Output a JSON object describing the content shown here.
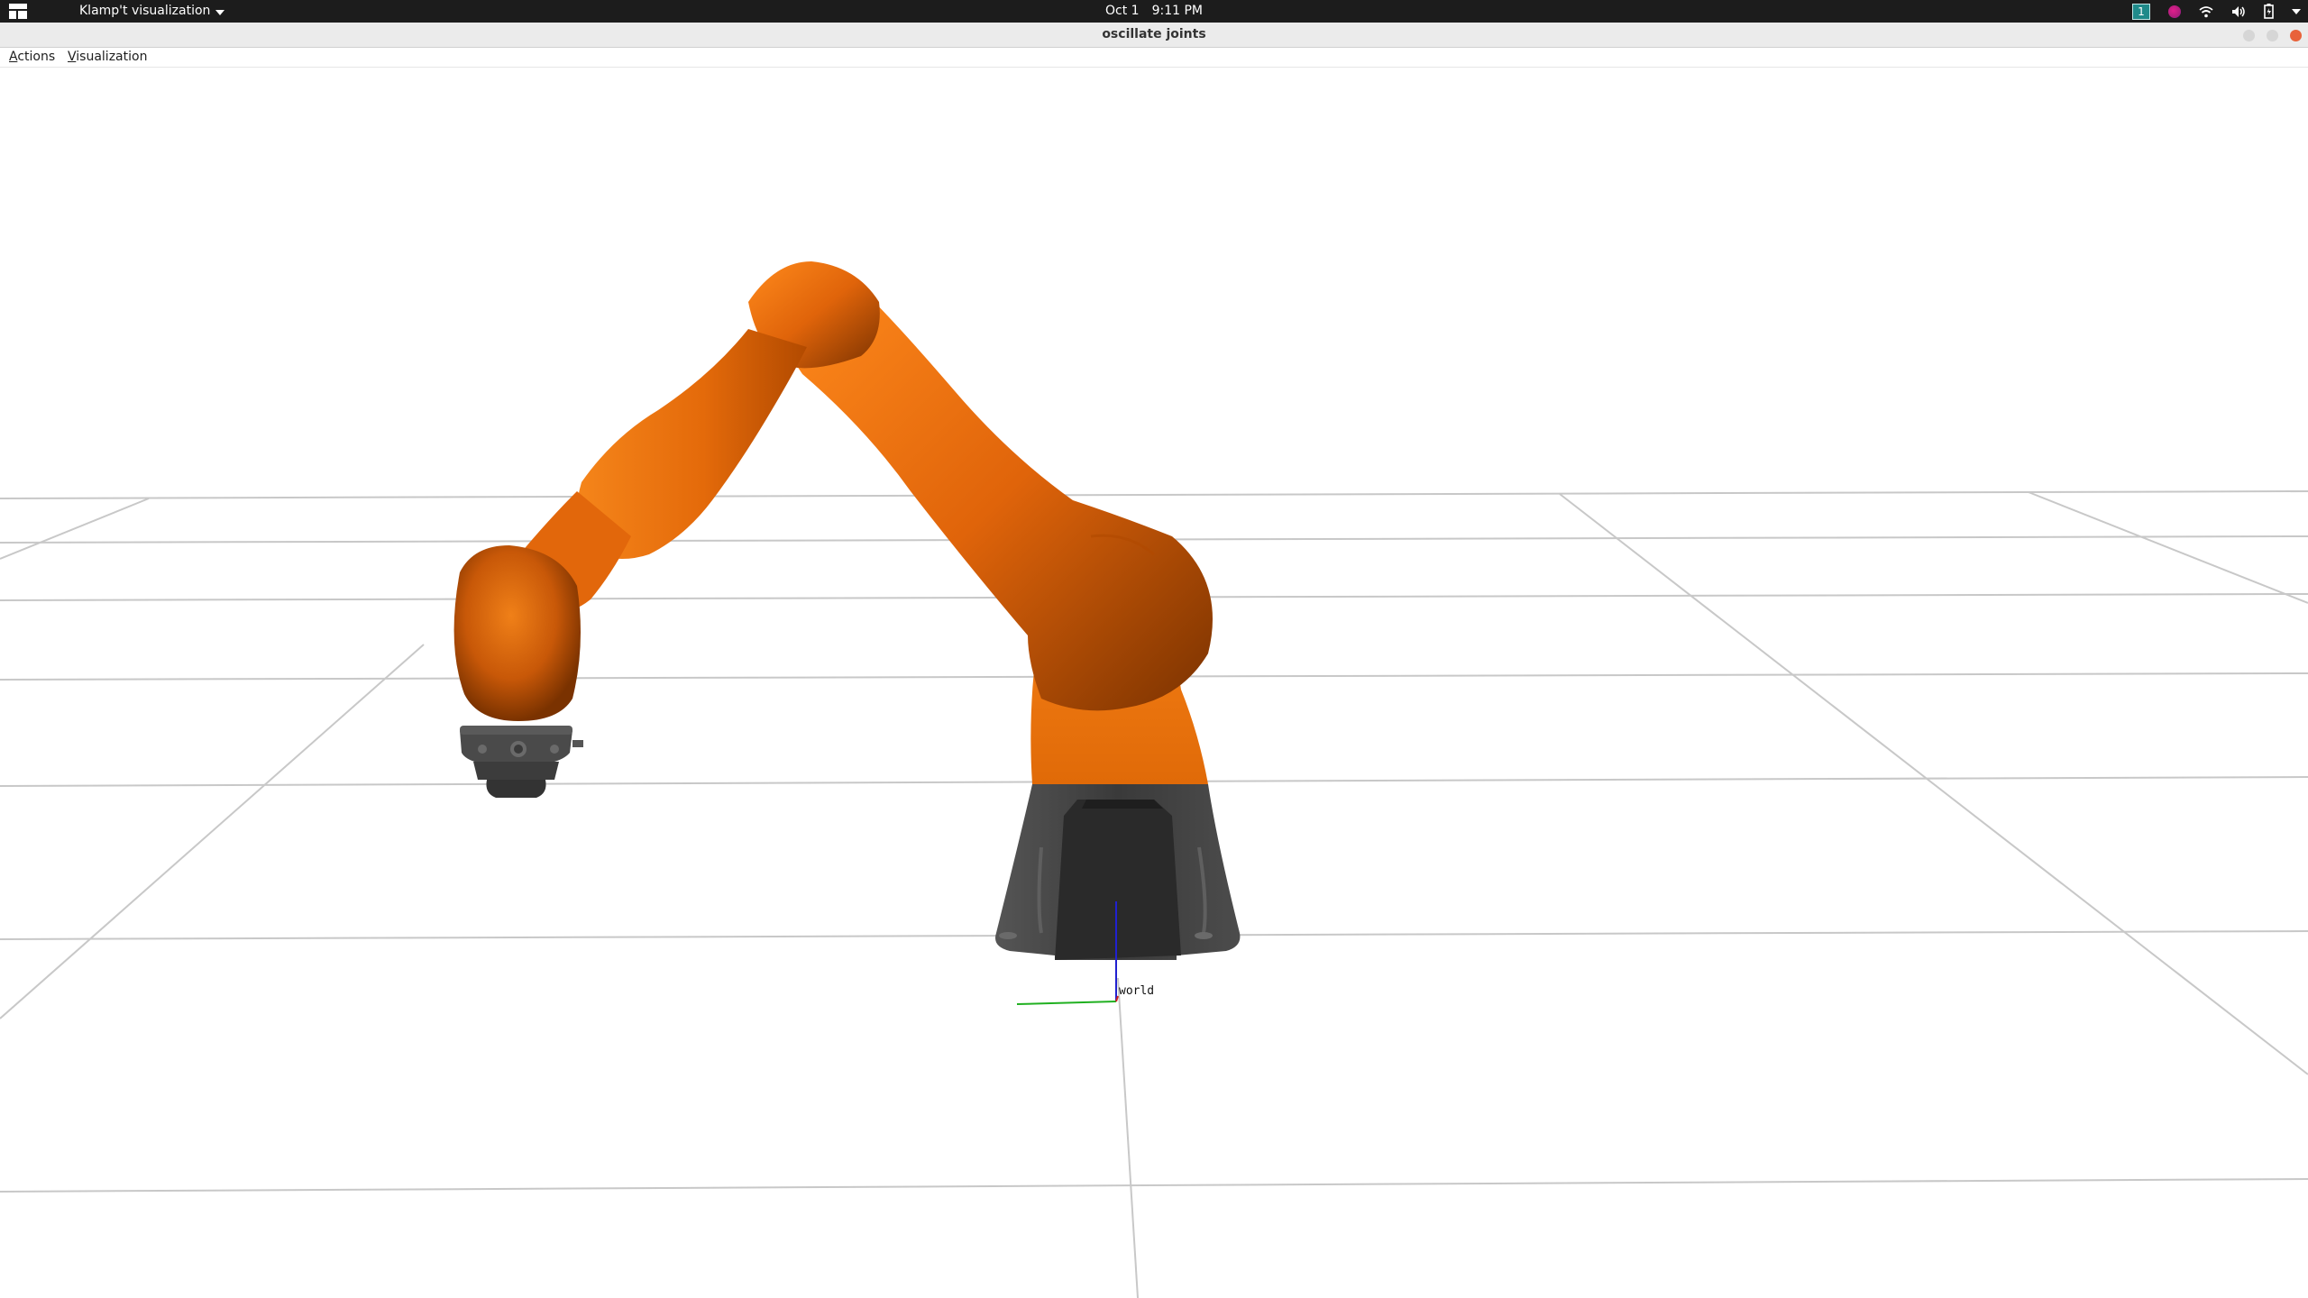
{
  "top_panel": {
    "app_menu_label": "Klamp't visualization",
    "date": "Oct 1",
    "time": "9:11 PM",
    "workspace_number": "1",
    "icons": [
      "activities-icon",
      "chevron-down-icon",
      "workspace-indicator",
      "slack-icon",
      "wifi-icon",
      "volume-icon",
      "battery-icon",
      "system-menu-chevron-icon"
    ]
  },
  "window": {
    "title": "oscillate joints"
  },
  "menubar": {
    "actions_label": "Actions",
    "visualization_label": "Visualization"
  },
  "viewport": {
    "world_label": "world",
    "robot_colors": {
      "link_orange": "#f07c12",
      "link_shadow": "#8a3a00",
      "base_dark": "#3c3c3c"
    },
    "grid_color": "#c8c8c8"
  }
}
